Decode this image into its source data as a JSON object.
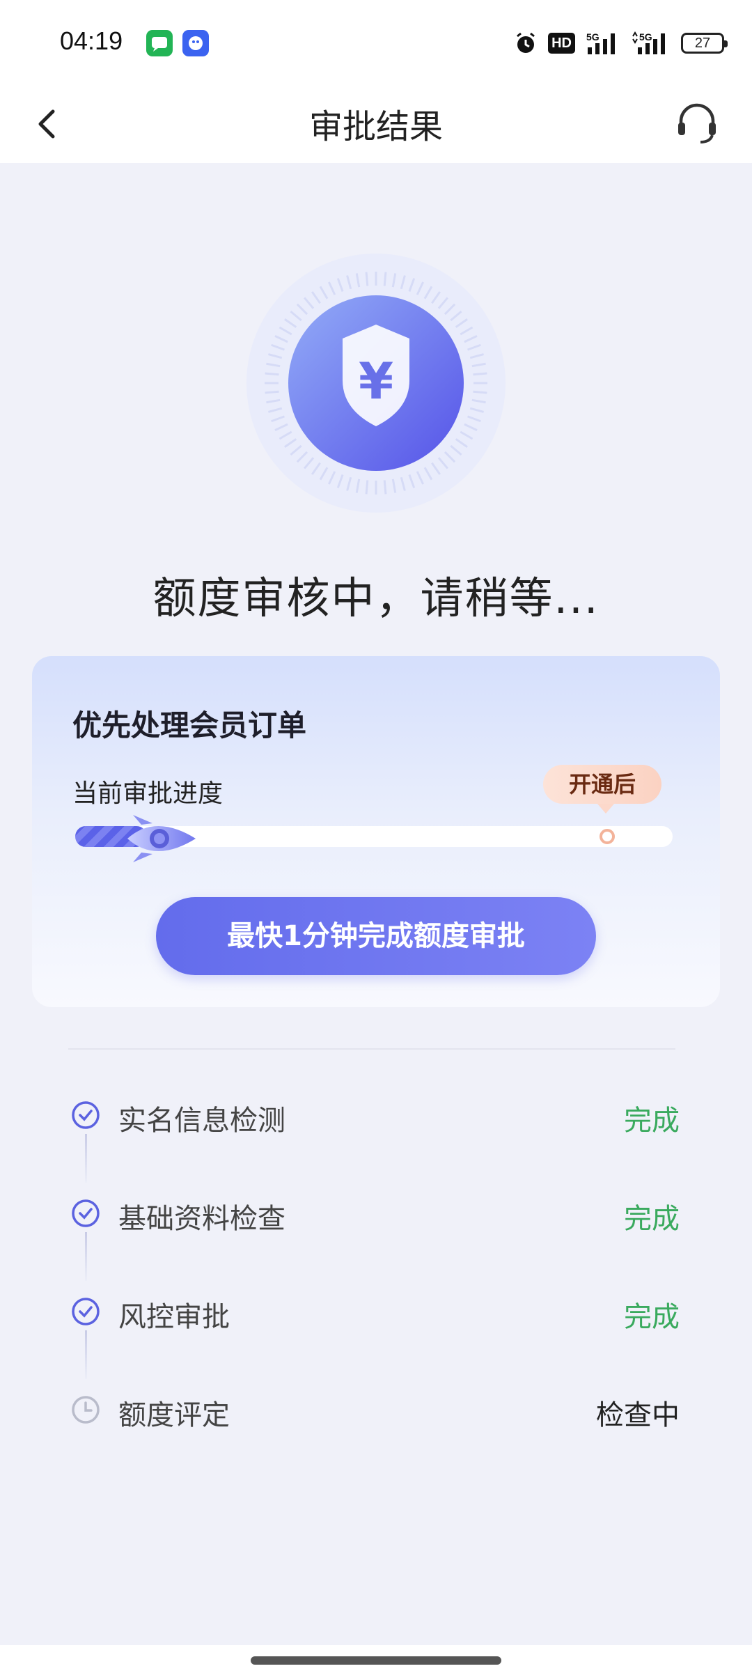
{
  "status_bar": {
    "time": "04:19",
    "apps": [
      "messages-icon",
      "qq-icon"
    ],
    "indicators": [
      "alarm-icon",
      "hd-icon",
      "signal-5g-icon",
      "signal-5g-icon"
    ],
    "hd_label": "HD",
    "battery": "27"
  },
  "nav": {
    "title": "审批结果",
    "back_icon": "chevron-left-icon",
    "support_icon": "headset-icon"
  },
  "hero": {
    "icon": "shield-yen-icon",
    "symbol": "¥",
    "title": "额度审核中，请稍等..."
  },
  "card": {
    "title": "优先处理会员订单",
    "progress_label": "当前审批进度",
    "after_badge": "开通后",
    "progress_current": 0.12,
    "progress_target": 0.89,
    "cta_label": "最快1分钟完成额度审批"
  },
  "steps": [
    {
      "label": "实名信息检测",
      "status": "完成",
      "state": "done"
    },
    {
      "label": "基础资料检查",
      "status": "完成",
      "state": "done"
    },
    {
      "label": "风控审批",
      "status": "完成",
      "state": "done"
    },
    {
      "label": "额度评定",
      "status": "检查中",
      "state": "pending"
    }
  ],
  "colors": {
    "accent": "#626aeb",
    "done": "#3aaa5e",
    "background": "#f0f1f9"
  }
}
